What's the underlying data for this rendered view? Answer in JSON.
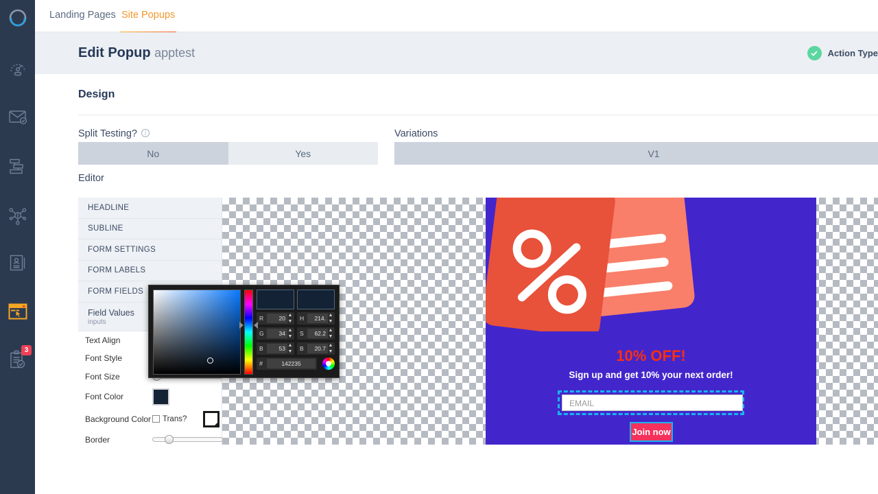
{
  "rail": {
    "items": [
      {
        "name": "logo",
        "icon": "circle-logo-icon"
      },
      {
        "name": "dashboard",
        "icon": "gauge-icon"
      },
      {
        "name": "email",
        "icon": "envelope-check-icon"
      },
      {
        "name": "workflows",
        "icon": "hierarchy-icon"
      },
      {
        "name": "automation",
        "icon": "network-nodes-icon"
      },
      {
        "name": "contacts",
        "icon": "contact-card-icon"
      },
      {
        "name": "site-popups",
        "icon": "browser-cursor-icon",
        "active": true
      },
      {
        "name": "tasks",
        "icon": "clipboard-check-icon",
        "badge": "3"
      }
    ]
  },
  "tabs": [
    {
      "label": "Landing Pages",
      "active": false
    },
    {
      "label": "Site Popups",
      "active": true
    }
  ],
  "header": {
    "title": "Edit Popup",
    "subtitle": "apptest",
    "action_type_label": "Action Type",
    "check_icon": "check-circle-icon",
    "check_color": "#5cd6a0"
  },
  "design": {
    "section_title": "Design",
    "split_testing_label": "Split Testing?",
    "info_icon": "info-icon",
    "split_options": [
      {
        "label": "No",
        "selected": true
      },
      {
        "label": "Yes",
        "selected": false
      }
    ],
    "variations_label": "Variations",
    "variations": [
      {
        "label": "V1",
        "selected": true
      }
    ],
    "editor_label": "Editor"
  },
  "editor": {
    "accordion": [
      {
        "label": "HEADLINE"
      },
      {
        "label": "SUBLINE"
      },
      {
        "label": "FORM SETTINGS"
      },
      {
        "label": "FORM LABELS"
      },
      {
        "label": "FORM FIELDS"
      }
    ],
    "panel": {
      "title": "Field Values",
      "subtitle": "inputs",
      "controls": [
        {
          "name": "text-align",
          "label": "Text Align",
          "type": "select"
        },
        {
          "name": "font-style",
          "label": "Font Style",
          "type": "select"
        },
        {
          "name": "font-size",
          "label": "Font Size",
          "type": "slider",
          "pos": 0
        },
        {
          "name": "font-color",
          "label": "Font Color",
          "type": "swatch",
          "value": "#142235"
        },
        {
          "name": "background-color",
          "label": "Background Color",
          "type": "swatch-trans",
          "trans_label": "Trans?",
          "trans_checked": false,
          "value": "#ffffff"
        },
        {
          "name": "border",
          "label": "Border",
          "type": "slider",
          "pos": 18
        }
      ]
    }
  },
  "preview": {
    "popup_bg": "#4226cc",
    "coupon_dark": "#e8513a",
    "coupon_light": "#f97f6a",
    "headline": "10% OFF!",
    "headline_color": "#fa2f0f",
    "subline": "Sign up and get 10% your next order!",
    "email_placeholder": "EMAIL",
    "button_label": "Join now",
    "button_color": "#f5315c",
    "selection_color": "#19b4ef",
    "graphic_icon": "discount-coupons-icon"
  },
  "color_picker": {
    "hex_label": "#",
    "hex_value": "142235",
    "preview_new": "#142235",
    "preview_old": "#142235",
    "rgb": [
      {
        "key": "R",
        "value": "20"
      },
      {
        "key": "G",
        "value": "34"
      },
      {
        "key": "B",
        "value": "53"
      }
    ],
    "hsb": [
      {
        "key": "H",
        "value": "214."
      },
      {
        "key": "S",
        "value": "62.2"
      },
      {
        "key": "B",
        "value": "20.7"
      }
    ],
    "wheel_icon": "color-wheel-icon"
  }
}
